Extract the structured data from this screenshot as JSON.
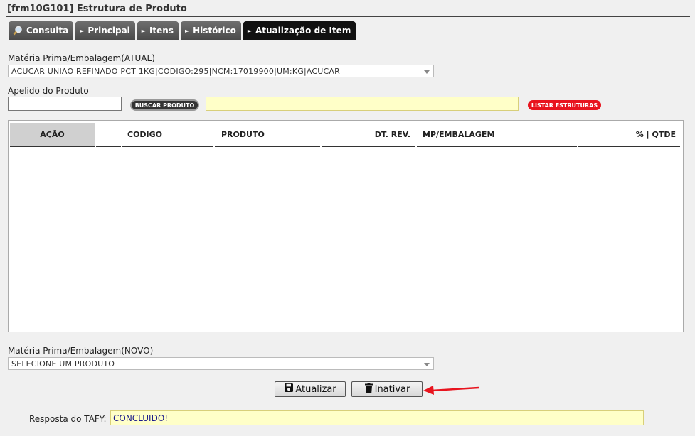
{
  "window": {
    "title": "[frm10G101] Estrutura de Produto"
  },
  "tabs": [
    {
      "label": "Consulta",
      "icon": "magnifier-icon"
    },
    {
      "label": "Principal",
      "icon": "arrow-right-icon"
    },
    {
      "label": "Itens",
      "icon": "arrow-right-icon"
    },
    {
      "label": "Histórico",
      "icon": "arrow-right-icon"
    },
    {
      "label": "Atualização de Item",
      "icon": "arrow-right-icon",
      "active": true
    }
  ],
  "materia_atual": {
    "label": "Matéria Prima/Embalagem(ATUAL)",
    "value": "ACUCAR UNIAO REFINADO PCT 1KG|CODIGO:295|NCM:17019900|UM:KG|ACUCAR"
  },
  "apelido": {
    "label": "Apelido do Produto",
    "value": "",
    "buscar_label": "BUSCAR PRODUTO",
    "result_value": "",
    "listar_label": "LISTAR ESTRUTURAS"
  },
  "grid": {
    "columns": [
      "AÇÃO",
      "",
      "CODIGO",
      "PRODUTO",
      "DT. REV.",
      "MP/EMBALAGEM",
      "% | QTDE"
    ],
    "rows": []
  },
  "materia_novo": {
    "label": "Matéria Prima/Embalagem(NOVO)",
    "value": "SELECIONE UM PRODUTO"
  },
  "actions": {
    "atualizar_label": "Atualizar",
    "inativar_label": "Inativar"
  },
  "resposta": {
    "label": "Resposta do TAFY:",
    "value": "CONCLUIDO!"
  },
  "colors": {
    "accent_red": "#e8141e",
    "highlight_yellow": "#ffffc8",
    "tab_active": "#111111"
  }
}
